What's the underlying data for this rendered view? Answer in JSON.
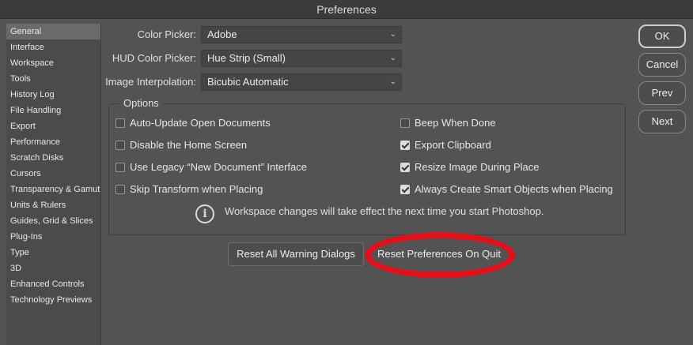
{
  "window": {
    "title": "Preferences"
  },
  "sidebar": {
    "items": [
      {
        "label": "General"
      },
      {
        "label": "Interface"
      },
      {
        "label": "Workspace"
      },
      {
        "label": "Tools"
      },
      {
        "label": "History Log"
      },
      {
        "label": "File Handling"
      },
      {
        "label": "Export"
      },
      {
        "label": "Performance"
      },
      {
        "label": "Scratch Disks"
      },
      {
        "label": "Cursors"
      },
      {
        "label": "Transparency & Gamut"
      },
      {
        "label": "Units & Rulers"
      },
      {
        "label": "Guides, Grid & Slices"
      },
      {
        "label": "Plug-Ins"
      },
      {
        "label": "Type"
      },
      {
        "label": "3D"
      },
      {
        "label": "Enhanced Controls"
      },
      {
        "label": "Technology Previews"
      }
    ],
    "selected": "General"
  },
  "settings": {
    "color_picker": {
      "label": "Color Picker:",
      "value": "Adobe"
    },
    "hud_color_picker": {
      "label": "HUD Color Picker:",
      "value": "Hue Strip (Small)"
    },
    "image_interpolation": {
      "label": "Image Interpolation:",
      "value": "Bicubic Automatic"
    }
  },
  "options": {
    "legend": "Options",
    "left": [
      {
        "label": "Auto-Update Open Documents",
        "checked": false
      },
      {
        "label": "Disable the Home Screen",
        "checked": false
      },
      {
        "label": "Use Legacy “New Document” Interface",
        "checked": false
      },
      {
        "label": "Skip Transform when Placing",
        "checked": false
      }
    ],
    "right": [
      {
        "label": "Beep When Done",
        "checked": false
      },
      {
        "label": "Export Clipboard",
        "checked": true
      },
      {
        "label": "Resize Image During Place",
        "checked": true
      },
      {
        "label": "Always Create Smart Objects when Placing",
        "checked": true
      }
    ],
    "notice": "Workspace changes will take effect the next time you start Photoshop."
  },
  "actions": {
    "reset_warnings": "Reset All Warning Dialogs",
    "reset_prefs": "Reset Preferences On Quit"
  },
  "dialog_buttons": {
    "ok": "OK",
    "cancel": "Cancel",
    "prev": "Prev",
    "next": "Next"
  },
  "colors": {
    "background": "#535353",
    "annotation": "#e3101a"
  },
  "icons": {
    "info": "info-icon",
    "chevron": "chevron-down-icon",
    "checkbox": "checkbox-icon"
  }
}
